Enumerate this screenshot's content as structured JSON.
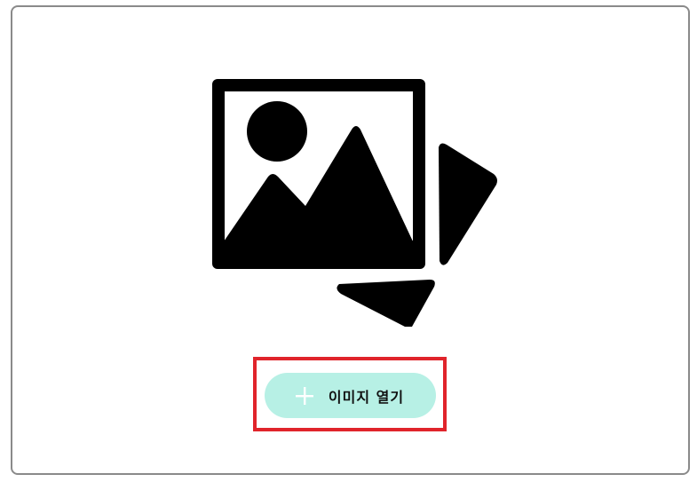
{
  "upload_panel": {
    "illustration_icon": "image-gallery-icon",
    "open_button": {
      "icon": "plus-icon",
      "label": "이미지 열기"
    },
    "highlight": "red-outline"
  },
  "colors": {
    "button_background": "#b7f0e5",
    "highlight_border": "#e0242b",
    "frame_border": "#8a8a8a",
    "icon_fill": "#000000",
    "plus_icon_color": "#ffffff"
  }
}
